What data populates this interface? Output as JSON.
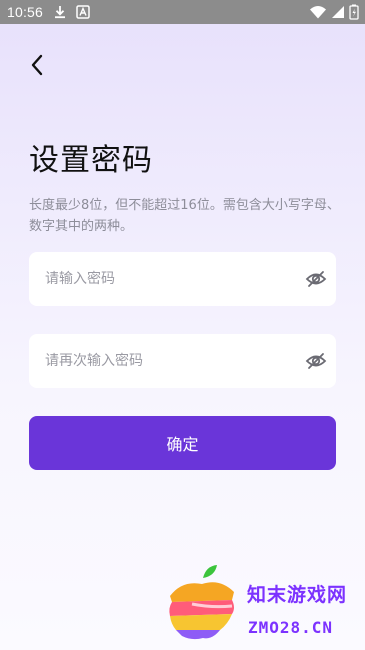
{
  "status_bar": {
    "time": "10:56",
    "left_icons": [
      "download-icon",
      "app-notification-icon"
    ],
    "right_icons": [
      "wifi-icon",
      "signal-icon",
      "battery-icon"
    ]
  },
  "header": {
    "back_icon": "chevron-left-icon"
  },
  "main": {
    "title": "设置密码",
    "hint": "长度最少8位，但不能超过16位。需包含大小写字母、数字其中的两种。",
    "password_field": {
      "placeholder": "请输入密码",
      "value": "",
      "toggle_icon": "eye-off-icon"
    },
    "confirm_password_field": {
      "placeholder": "请再次输入密码",
      "value": "",
      "toggle_icon": "eye-off-icon"
    },
    "confirm_button_label": "确定"
  },
  "watermark": {
    "name": "知末游戏网",
    "url": "ZMO28.CN"
  },
  "colors": {
    "accent": "#6a35d9",
    "hint_text": "#8d8d99",
    "status_bar": "#8c8c8c",
    "watermark": "#7c32ff"
  }
}
